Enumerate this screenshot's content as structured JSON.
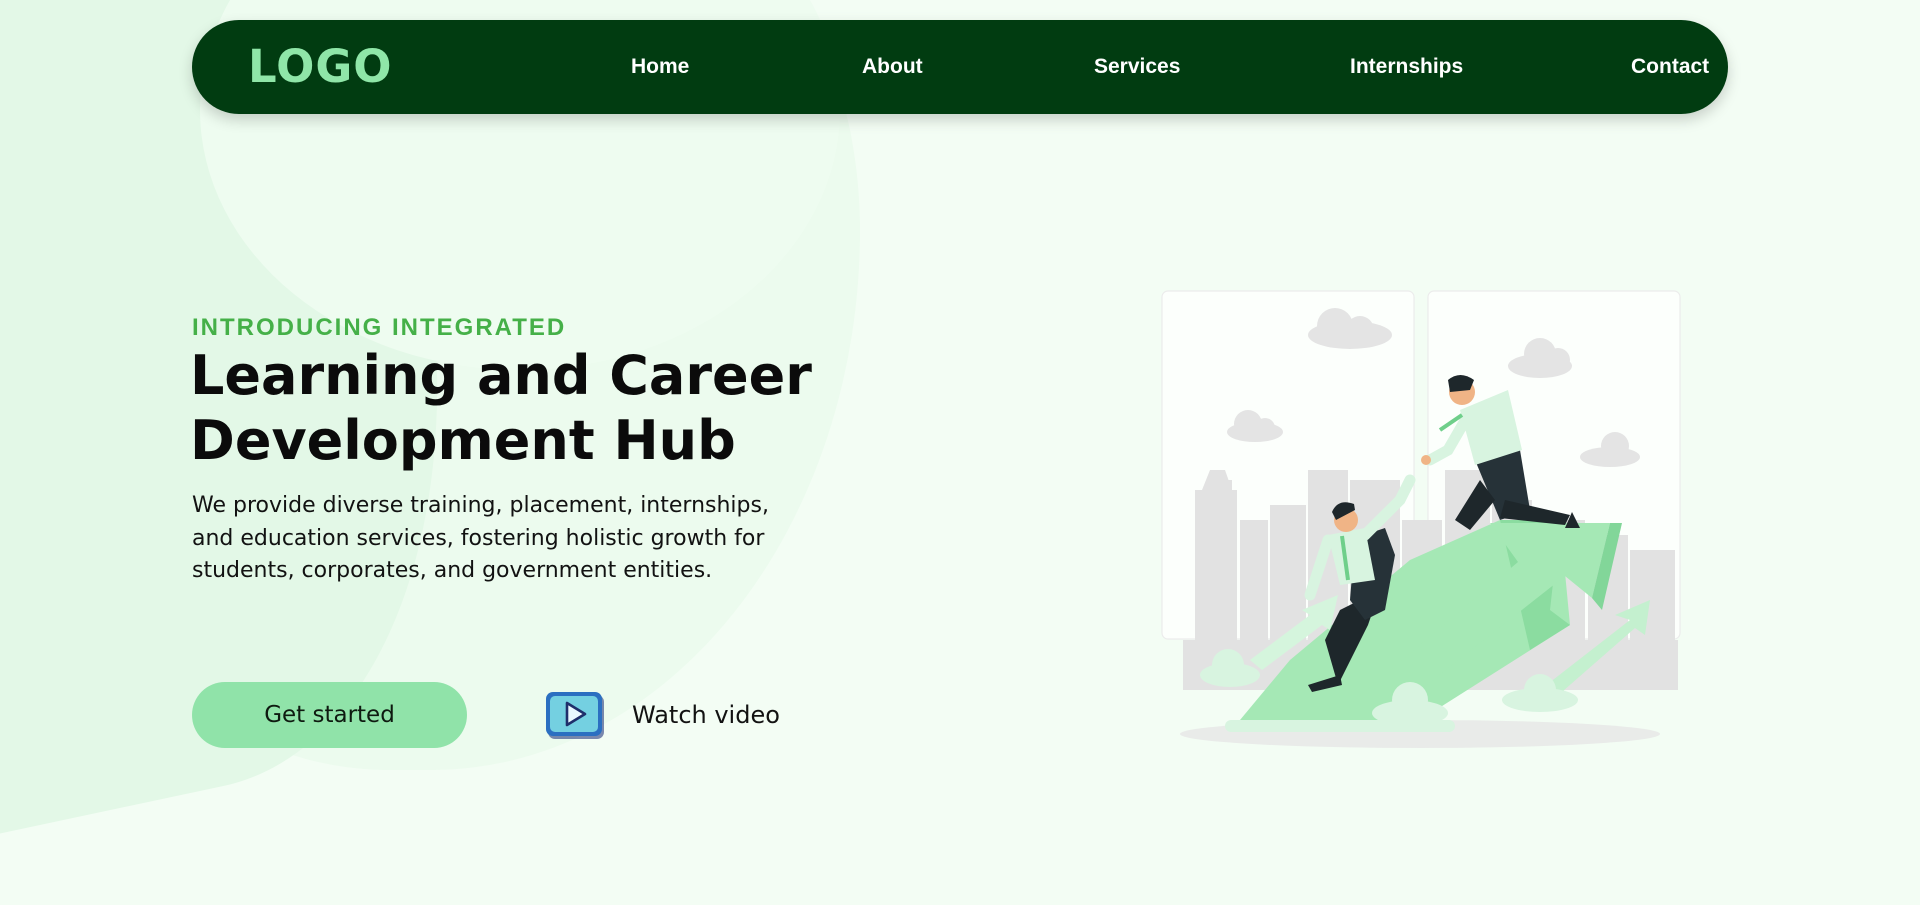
{
  "nav": {
    "logo": "LOGO",
    "links": [
      {
        "label": "Home"
      },
      {
        "label": "About"
      },
      {
        "label": "Services"
      },
      {
        "label": "Internships"
      },
      {
        "label": "Contact"
      }
    ]
  },
  "hero": {
    "eyebrow": "INTRODUCING INTEGRATED",
    "title_line1": "Learning and Career",
    "title_line2": "Development Hub",
    "description": "We provide diverse training, placement, internships, and education services, fostering holistic growth for students, corporates, and government entities.",
    "cta_label": "Get started",
    "video_label": "Watch video"
  },
  "icons": {
    "play": "play-icon"
  },
  "colors": {
    "background": "#f3fdf4",
    "navbar": "#013c11",
    "logo": "#8fe6a8",
    "accent": "#45b048",
    "button": "#90e3a9",
    "illustration_arrow": "#a5e8b5"
  }
}
